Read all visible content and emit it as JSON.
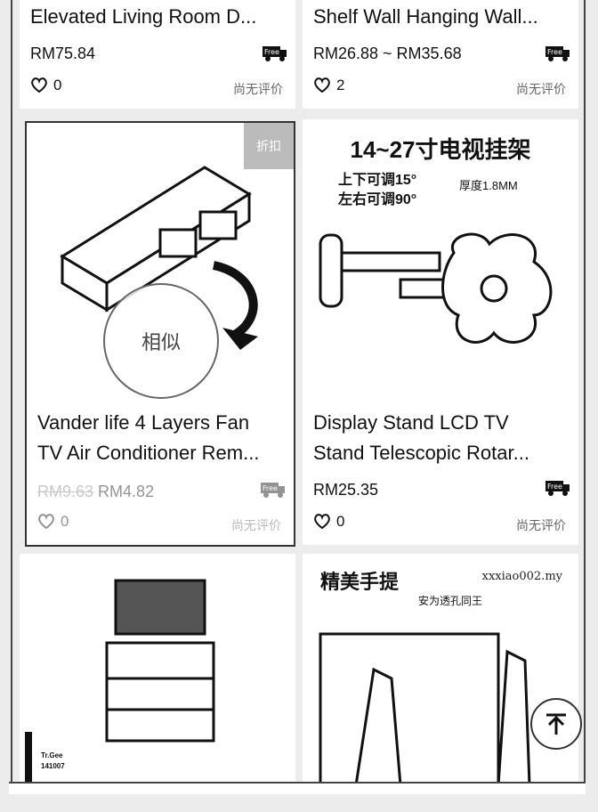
{
  "products": [
    {
      "title": "Elevated Living Room D...",
      "price": "RM75.84",
      "likes": "0",
      "review": "尚无评价"
    },
    {
      "title": "Shelf Wall Hanging Wall...",
      "price": "RM26.88 ~ RM35.68",
      "likes": "2",
      "review": "尚无评价"
    },
    {
      "title_line1": "Vander life 4 Layers Fan",
      "title_line2": "TV Air Conditioner Rem...",
      "old_price": "RM9.63",
      "price": "RM4.82",
      "likes": "0",
      "review": "尚无评价",
      "badge": "折扣",
      "similar": "相似"
    },
    {
      "title_line1": "Display Stand  LCD TV",
      "title_line2": "Stand Telescopic Rotar...",
      "price": "RM25.35",
      "likes": "0",
      "review": "尚无评价",
      "image_text": {
        "headline": "14~27寸电视挂架",
        "spec1": "上下可调15°",
        "spec2": "左右可调90°",
        "spec3": "厚度1.8MM"
      }
    },
    {
      "image_text": {
        "brand": "Tr.Gee",
        "code": "141007"
      }
    },
    {
      "image_text": {
        "headline": "精美手提",
        "watermark": "xxxiao002.my",
        "sub": "安为透孔同王"
      }
    }
  ],
  "free_label": "Free",
  "icons": {
    "free_shipping": "truck-free-icon",
    "like": "heart-icon",
    "scroll_top": "arrow-up-icon"
  }
}
